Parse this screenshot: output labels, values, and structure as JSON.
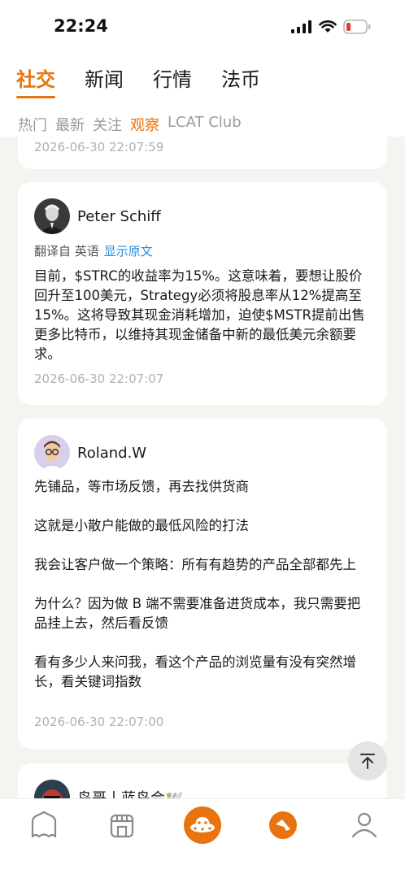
{
  "status_bar": {
    "time": "22:24",
    "icons": [
      "signal-icon",
      "wifi-icon",
      "battery-low-icon"
    ]
  },
  "main_tabs": [
    {
      "label": "社交",
      "active": true
    },
    {
      "label": "新闻",
      "active": false
    },
    {
      "label": "行情",
      "active": false
    },
    {
      "label": "法币",
      "active": false
    }
  ],
  "sub_tabs": [
    {
      "label": "热门",
      "active": false
    },
    {
      "label": "最新",
      "active": false
    },
    {
      "label": "关注",
      "active": false
    },
    {
      "label": "观察",
      "active": true
    },
    {
      "label": "LCAT Club",
      "active": false
    }
  ],
  "posts": [
    {
      "timestamp": "2026-06-30 22:07:59"
    },
    {
      "author": "Peter Schiff",
      "translate_from": "翻译自 英语",
      "show_original": "显示原文",
      "body": "目前，$STRC的收益率为15%。这意味着，要想让股价回升至100美元，Strategy必须将股息率从12%提高至15%。这将导致其现金消耗增加，迫使$MSTR提前出售更多比特币，以维持其现金储备中新的最低美元余额要求。",
      "timestamp": "2026-06-30 22:07:07"
    },
    {
      "author": "Roland.W",
      "paragraphs": [
        "先铺品，等市场反馈，再去找供货商",
        "这就是小散户能做的最低风险的打法",
        "我会让客户做一个策略：所有有趋势的产品全部都先上",
        "为什么？因为做 B 端不需要准备进货成本，我只需要把品挂上去，然后看反馈",
        "看有多少人来问我，看这个产品的浏览量有没有突然增长，看关键词指数"
      ],
      "timestamp": "2026-06-30 22:07:00"
    },
    {
      "author": "鸟哥丨蓝鸟会🕊️"
    }
  ],
  "accent_color": "#e8730f",
  "link_color": "#2a8ce0",
  "bottom_nav": [
    "home-icon",
    "market-icon",
    "social-ufo-icon",
    "discover-icon",
    "profile-icon"
  ]
}
